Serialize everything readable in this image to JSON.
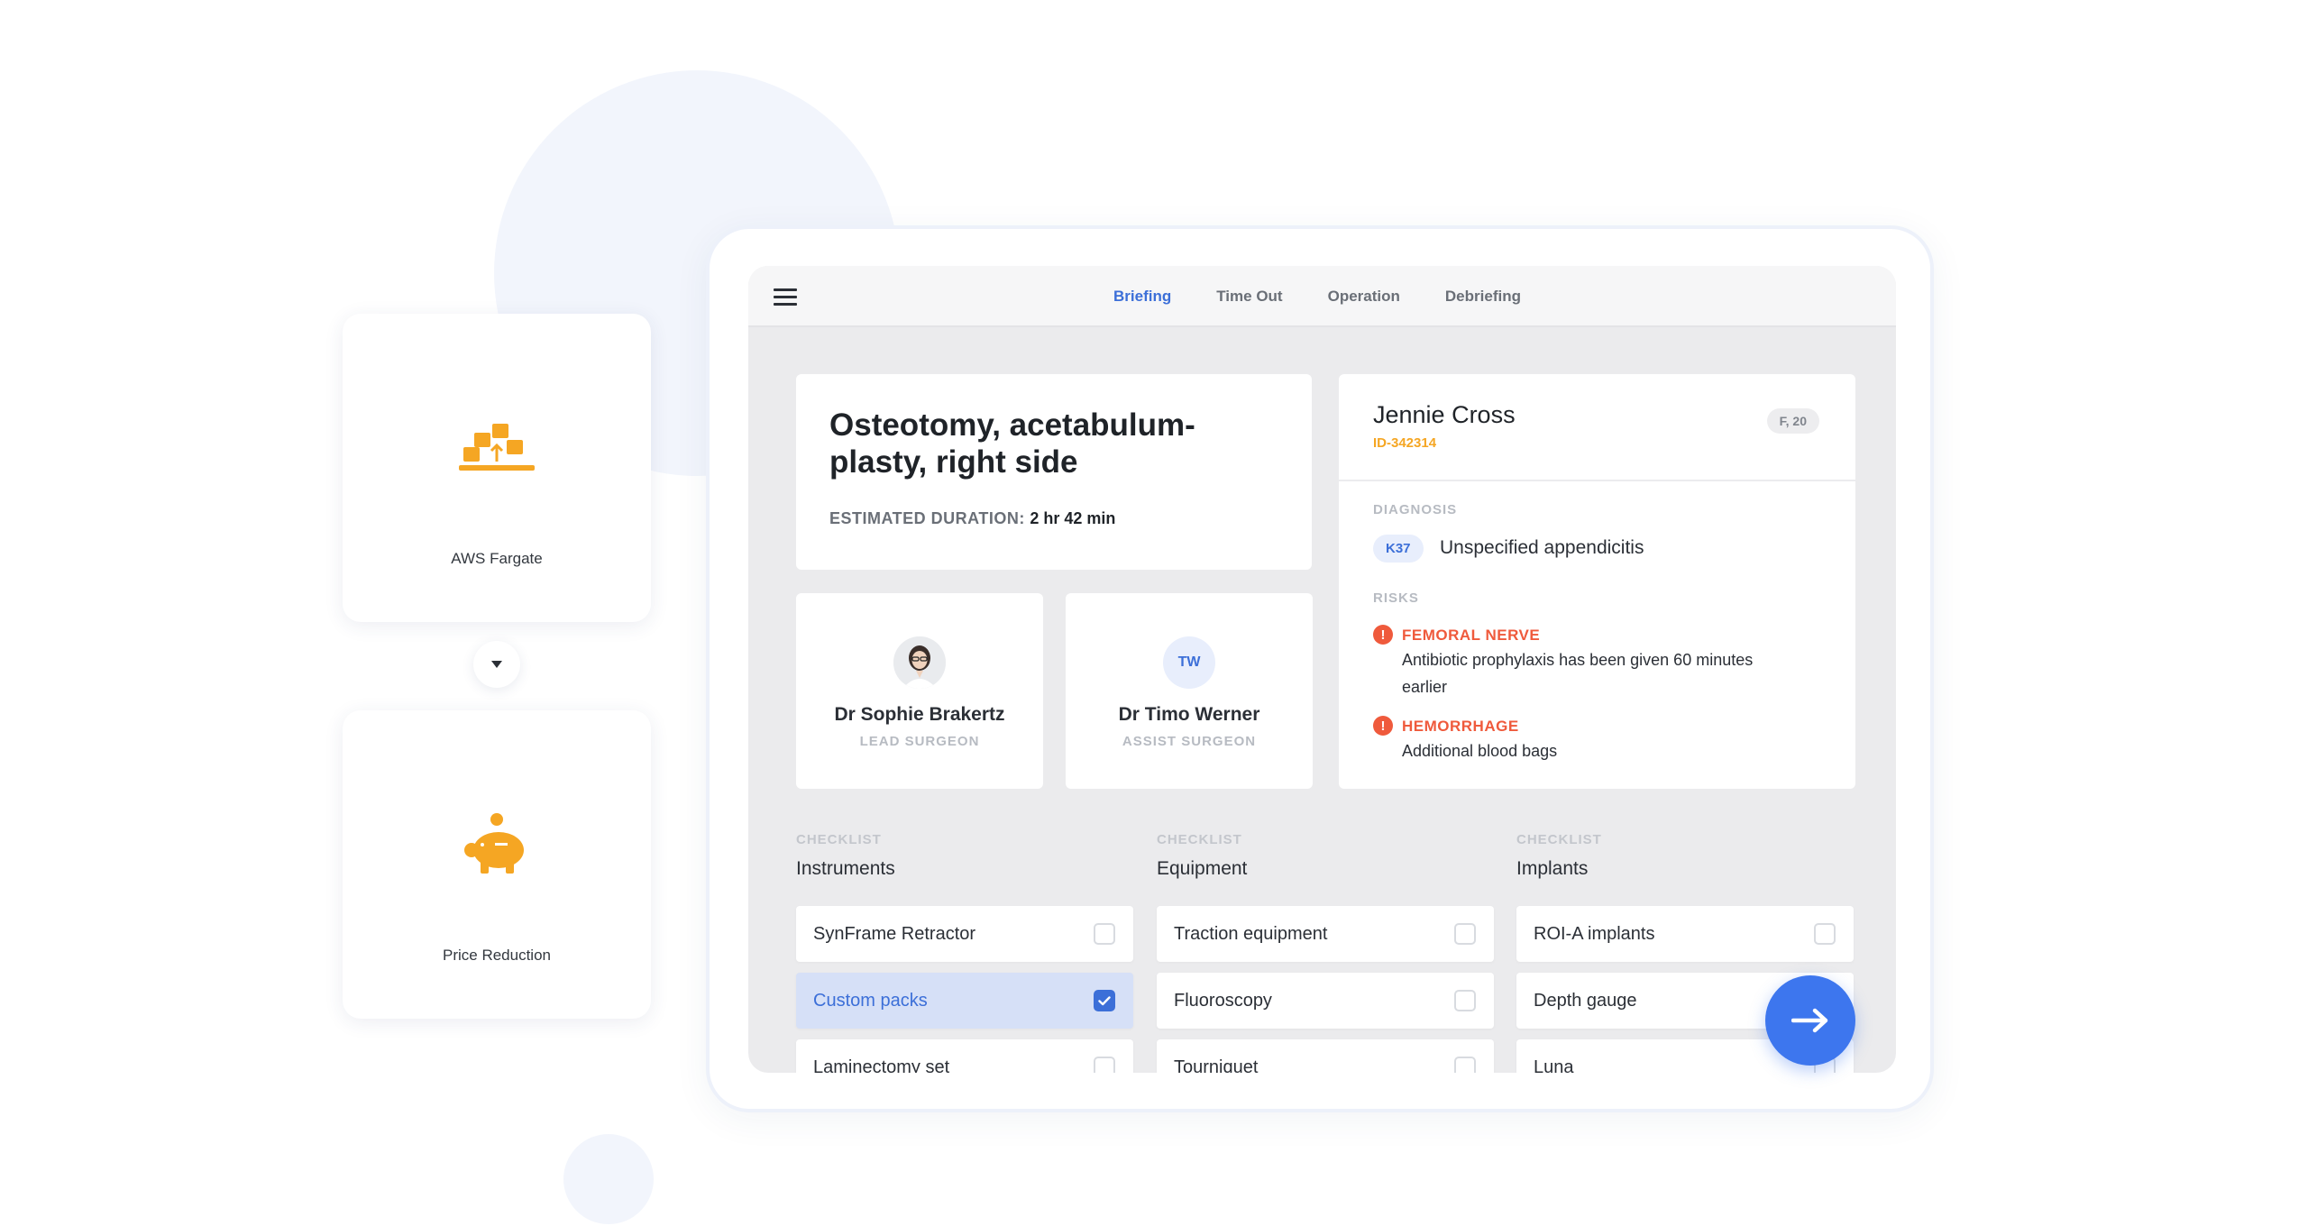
{
  "left_panel": {
    "cards": [
      {
        "label": "AWS Fargate",
        "icon": "container-upload-icon"
      },
      {
        "label": "Price Reduction",
        "icon": "piggy-bank-icon"
      }
    ],
    "connector_icon": "chevron-down-icon"
  },
  "colors": {
    "accent_blue": "#3c6fd8",
    "fab_blue": "#3d76ee",
    "orange": "#f5a623",
    "risk_red": "#ef5a3c",
    "screen_bg": "#ebebed"
  },
  "nav": {
    "menu_icon": "hamburger-icon",
    "tabs": [
      "Briefing",
      "Time Out",
      "Operation",
      "Debriefing"
    ],
    "active_tab": "Briefing"
  },
  "procedure": {
    "title": "Osteotomy, acetabulum-plasty, right side",
    "duration_label": "ESTIMATED DURATION:",
    "duration_value": "2 hr 42 min"
  },
  "surgeons": [
    {
      "name": "Dr Sophie Brakertz",
      "role": "LEAD SURGEON",
      "avatar": "photo"
    },
    {
      "name": "Dr Timo Werner",
      "role": "ASSIST SURGEON",
      "initials": "TW"
    }
  ],
  "patient": {
    "name": "Jennie Cross",
    "id": "ID-342314",
    "badge": "F, 20",
    "diagnosis_label": "DIAGNOSIS",
    "diagnosis_code": "K37",
    "diagnosis_text": "Unspecified appendicitis",
    "risks_label": "RISKS",
    "risks": [
      {
        "title": "FEMORAL NERVE",
        "text": "Antibiotic prophylaxis has been given 60 minutes earlier"
      },
      {
        "title": "HEMORRHAGE",
        "text": "Additional blood bags"
      }
    ]
  },
  "checklists": [
    {
      "tag": "CHECKLIST",
      "name": "Instruments",
      "items": [
        {
          "label": "SynFrame Retractor",
          "checked": false
        },
        {
          "label": "Custom packs",
          "checked": true
        },
        {
          "label": "Laminectomy set",
          "checked": false
        }
      ]
    },
    {
      "tag": "CHECKLIST",
      "name": "Equipment",
      "items": [
        {
          "label": "Traction equipment",
          "checked": false
        },
        {
          "label": "Fluoroscopy",
          "checked": false
        },
        {
          "label": "Tourniquet",
          "checked": false
        }
      ]
    },
    {
      "tag": "CHECKLIST",
      "name": "Implants",
      "items": [
        {
          "label": "ROI-A implants",
          "checked": false
        },
        {
          "label": "Depth gauge",
          "checked": false
        },
        {
          "label": "Luna",
          "checked": false
        }
      ]
    }
  ],
  "fab": {
    "icon": "arrow-right-icon"
  }
}
